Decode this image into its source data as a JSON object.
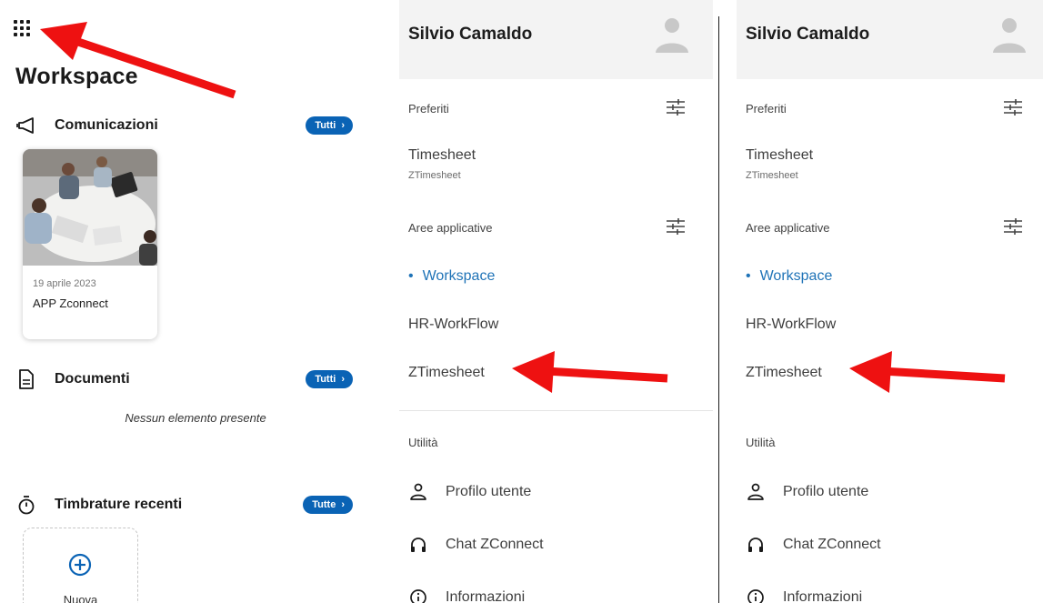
{
  "workspace": {
    "title": "Workspace",
    "sections": {
      "comunicazioni": {
        "label": "Comunicazioni",
        "button": "Tutti"
      },
      "documenti": {
        "label": "Documenti",
        "button": "Tutti"
      },
      "timbrature": {
        "label": "Timbrature recenti",
        "button": "Tutte"
      }
    },
    "news_card": {
      "date": "19 aprile 2023",
      "title": "APP Zconnect"
    },
    "documents_empty": "Nessun elemento presente",
    "new_card_label": "Nuova"
  },
  "menu": {
    "user_name": "Silvio Camaldo",
    "preferiti_label": "Preferiti",
    "favorite": {
      "label": "Timesheet",
      "sub": "ZTimesheet"
    },
    "aree_label": "Aree applicative",
    "areas": [
      {
        "label": "Workspace",
        "active": true
      },
      {
        "label": "HR-WorkFlow",
        "active": false
      },
      {
        "label": "ZTimesheet",
        "active": false
      }
    ],
    "utilita_label": "Utilità",
    "utilities": [
      {
        "label": "Profilo utente",
        "icon": "person-icon"
      },
      {
        "label": "Chat ZConnect",
        "icon": "headset-icon"
      },
      {
        "label": "Informazioni",
        "icon": "info-icon"
      }
    ]
  },
  "colors": {
    "accent": "#0a63b5",
    "active_link": "#1f73b7",
    "annotation_arrow": "#ee1111"
  }
}
